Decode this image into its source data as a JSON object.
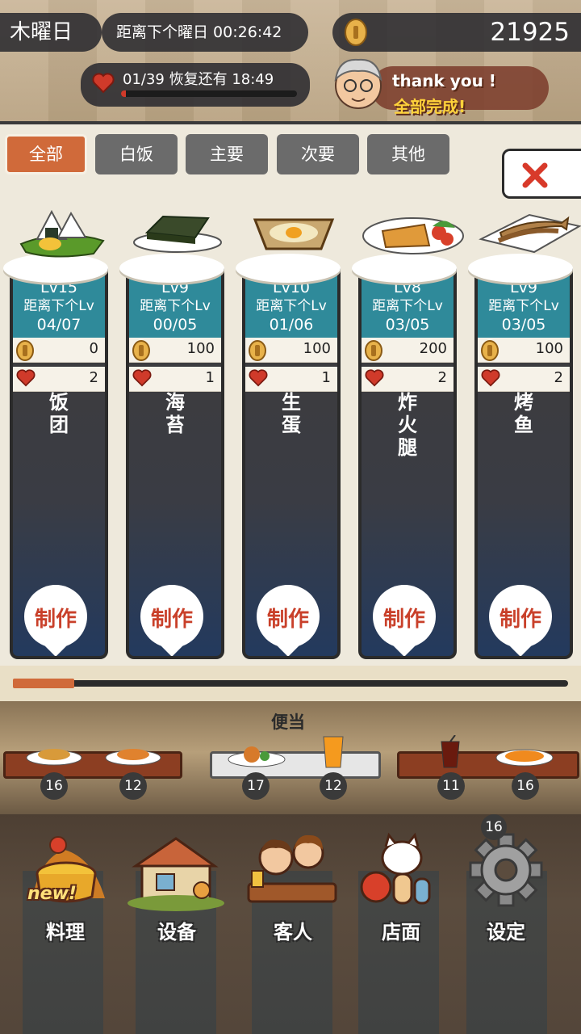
{
  "header": {
    "weekday": "木曜日",
    "timer_label": "距离下个曜日 00:26:42",
    "coins": "21925",
    "stamina_text": "01/39  恢复还有  18:49",
    "stamina_fraction": 0.026,
    "banner_line1": "thank  you !",
    "banner_line2": "全部完成!"
  },
  "tabs": [
    "全部",
    "白饭",
    "主要",
    "次要",
    "其他"
  ],
  "active_tab": "全部",
  "dishes": [
    {
      "lv": "Lv15",
      "next_label": "距离下个Lv",
      "progress": "04/07",
      "coin": "0",
      "hearts": "2",
      "name": "饭团",
      "make": "制作"
    },
    {
      "lv": "Lv9",
      "next_label": "距离下个Lv",
      "progress": "00/05",
      "coin": "100",
      "hearts": "1",
      "name": "海苔",
      "make": "制作"
    },
    {
      "lv": "Lv10",
      "next_label": "距离下个Lv",
      "progress": "01/06",
      "coin": "100",
      "hearts": "1",
      "name": "生蛋",
      "make": "制作"
    },
    {
      "lv": "Lv8",
      "next_label": "距离下个Lv",
      "progress": "03/05",
      "coin": "200",
      "hearts": "2",
      "name": "炸火腿",
      "make": "制作"
    },
    {
      "lv": "Lv9",
      "next_label": "距离下个Lv",
      "progress": "03/05",
      "coin": "100",
      "hearts": "2",
      "name": "烤鱼",
      "make": "制作"
    }
  ],
  "scroll_fraction": 0.11,
  "bento": {
    "label": "便当",
    "counts": [
      "16",
      "12",
      "17",
      "12",
      "11",
      "16"
    ]
  },
  "nav": {
    "new_badge": "new!",
    "items": [
      "料理",
      "设备",
      "客人",
      "店面",
      "设定"
    ],
    "settings_count": "16"
  },
  "colors": {
    "accent": "#d06a3a",
    "level_box": "#2f8a9a",
    "make_text": "#c9402a",
    "heart": "#d03a2a"
  }
}
